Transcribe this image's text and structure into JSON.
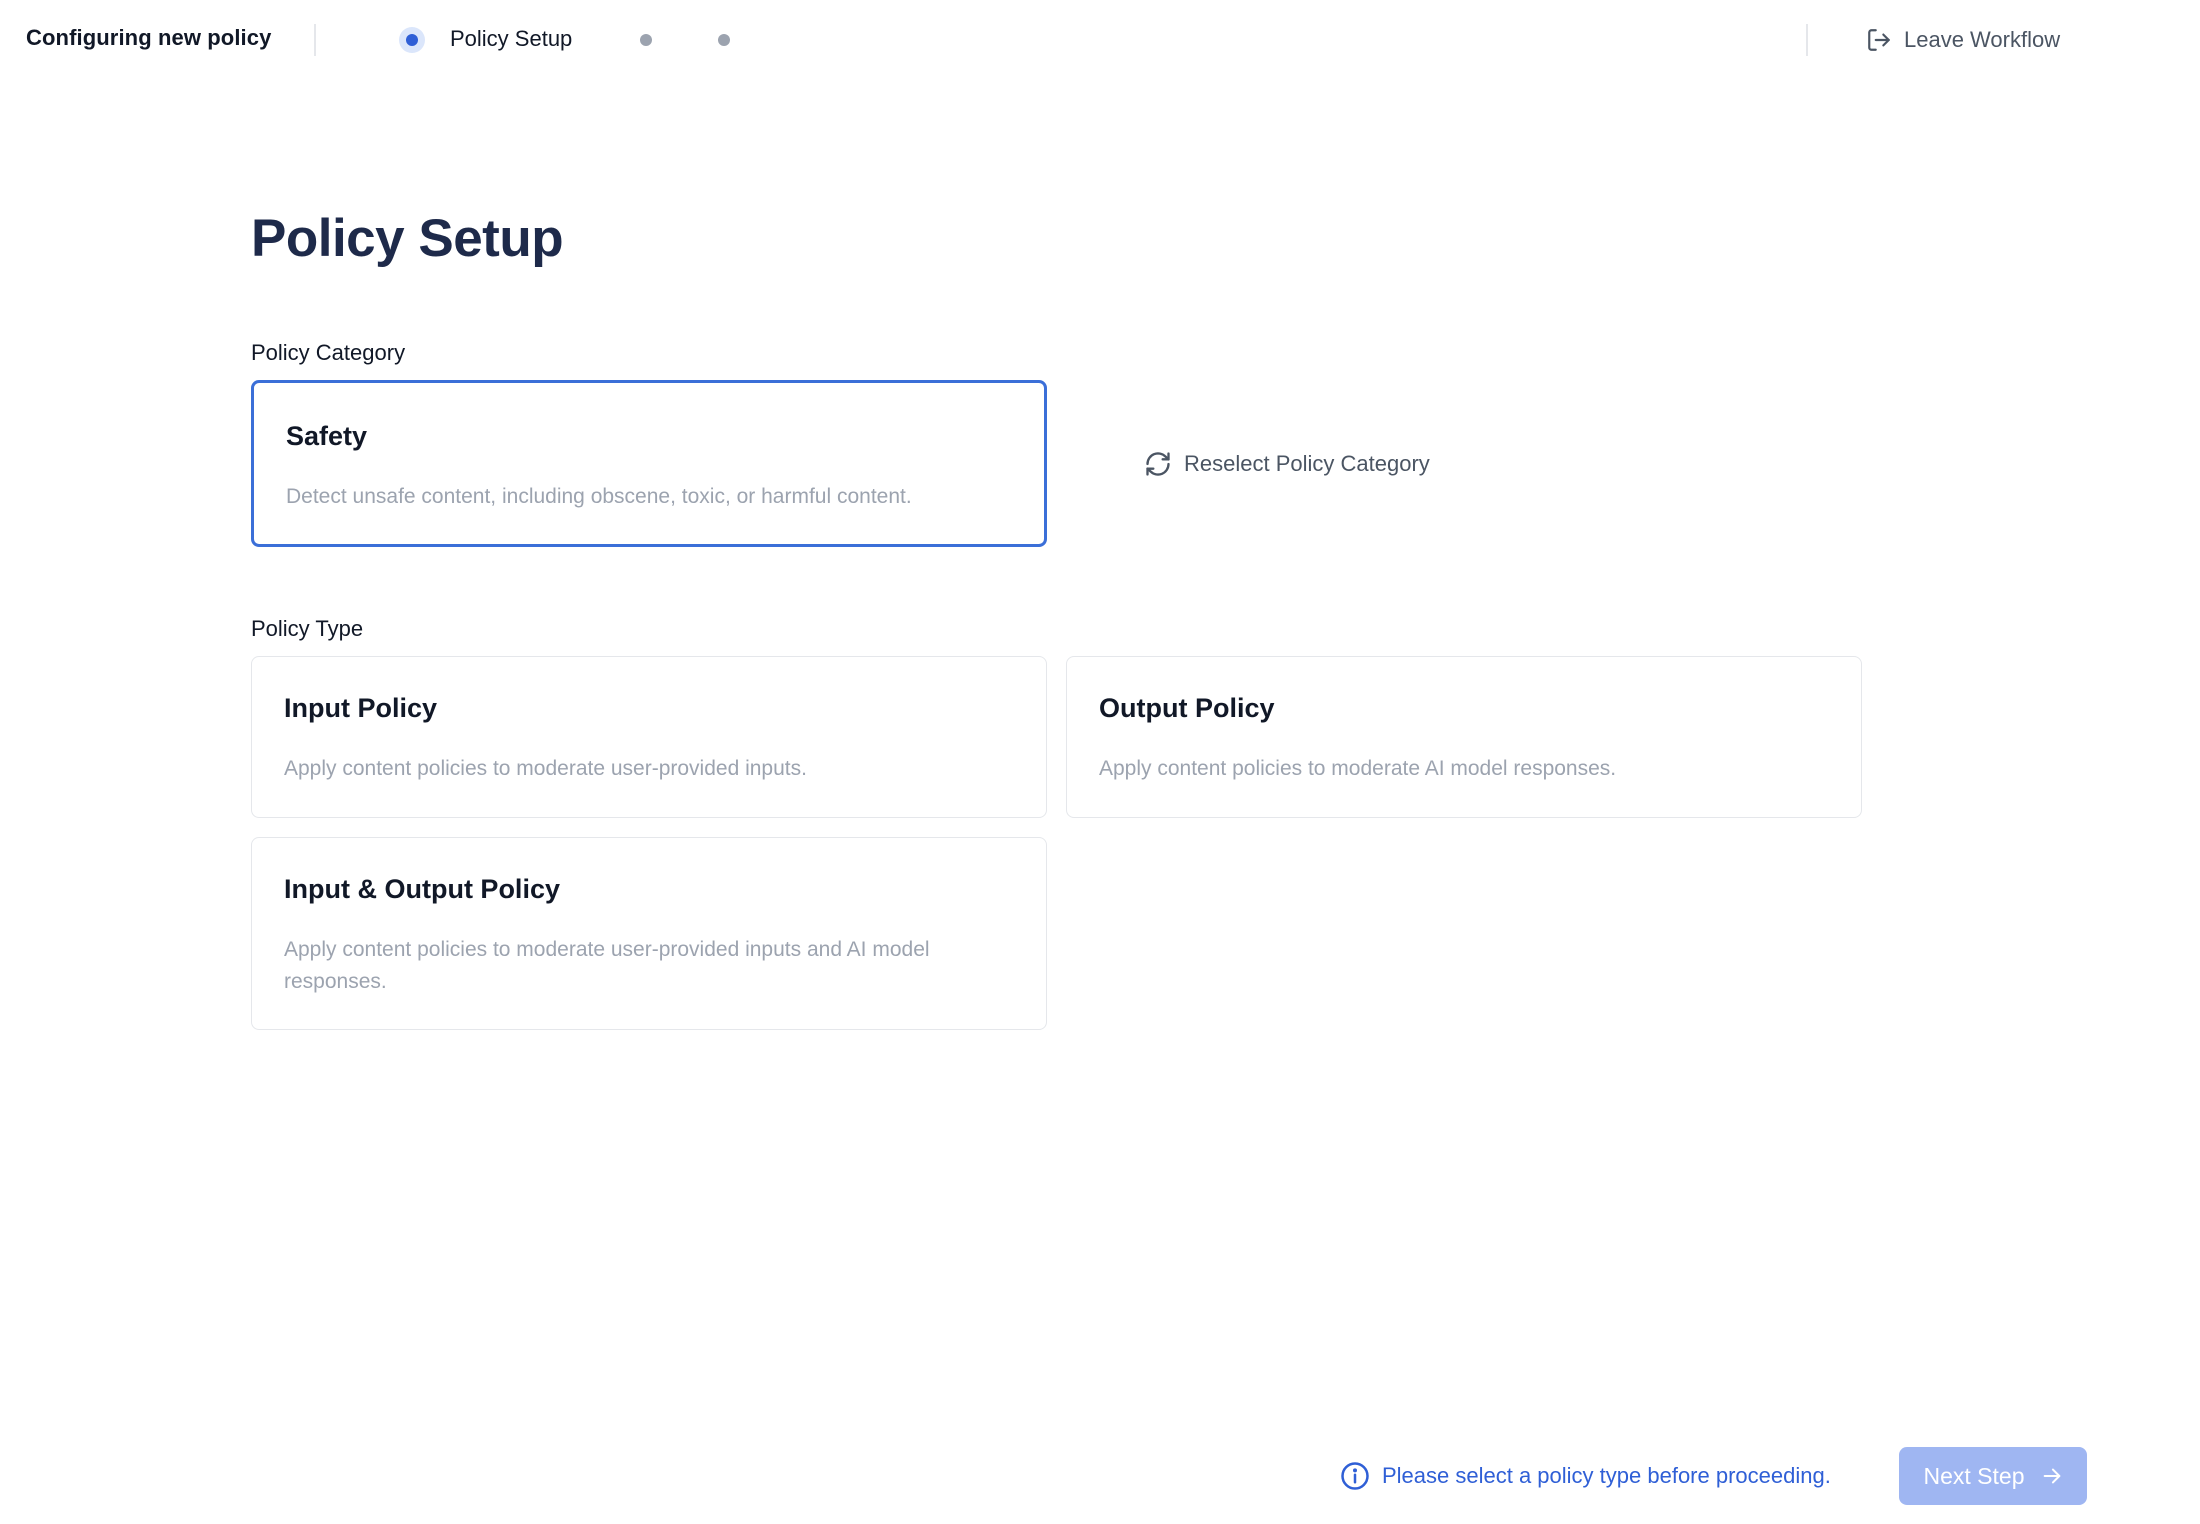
{
  "header": {
    "title": "Configuring new policy",
    "steps": [
      {
        "label": "Policy Setup",
        "state": "active"
      },
      {
        "label": "",
        "state": "upcoming"
      },
      {
        "label": "",
        "state": "upcoming"
      }
    ],
    "leave_label": "Leave Workflow",
    "leave_icon": "log-out-icon"
  },
  "page": {
    "title": "Policy Setup"
  },
  "category": {
    "label": "Policy Category",
    "selected": {
      "title": "Safety",
      "description": "Detect unsafe content, including obscene, toxic, or harmful content."
    },
    "reselect_label": "Reselect Policy Category",
    "reselect_icon": "refresh-icon"
  },
  "policy_type": {
    "label": "Policy Type",
    "options": [
      {
        "title": "Input Policy",
        "description": "Apply content policies to moderate user-provided inputs."
      },
      {
        "title": "Output Policy",
        "description": "Apply content policies to moderate AI model responses."
      },
      {
        "title": "Input & Output Policy",
        "description": "Apply content policies to moderate user-provided inputs and AI model responses."
      }
    ]
  },
  "footer": {
    "hint": "Please select a policy type before proceeding.",
    "hint_icon": "info-icon",
    "next_label": "Next Step",
    "next_icon": "arrow-right-icon"
  },
  "colors": {
    "accent": "#2f5fd6",
    "selected_border": "#3b6fd8",
    "disabled_button": "#9fb6f2",
    "title_text": "#1e2a4a"
  }
}
